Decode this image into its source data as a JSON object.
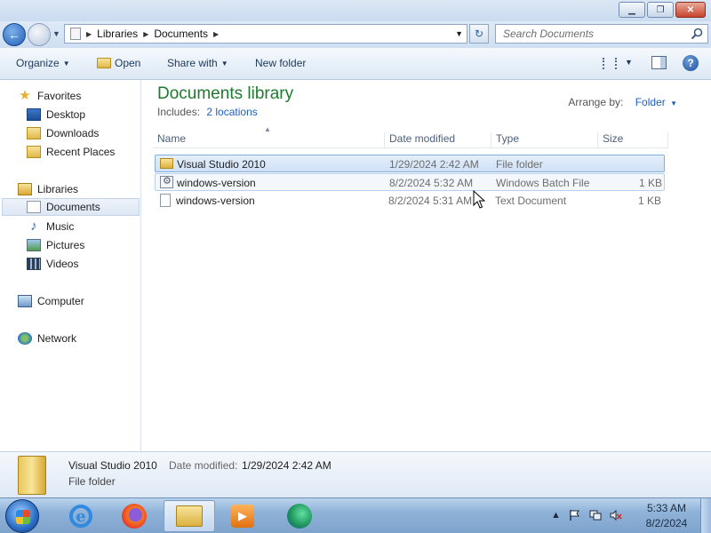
{
  "window": {
    "minimize_glyph": "▁",
    "maximize_glyph": "❐",
    "close_glyph": "✕"
  },
  "navbar": {
    "back_glyph": "←",
    "breadcrumbs": [
      "Libraries",
      "Documents"
    ],
    "search_placeholder": "Search Documents",
    "refresh_glyph": "↻"
  },
  "commands": {
    "organize": "Organize",
    "open": "Open",
    "share_with": "Share with",
    "new_folder": "New folder",
    "help_glyph": "?"
  },
  "sidebar": {
    "favorites": {
      "label": "Favorites",
      "items": [
        "Desktop",
        "Downloads",
        "Recent Places"
      ]
    },
    "libraries": {
      "label": "Libraries",
      "items": [
        "Documents",
        "Music",
        "Pictures",
        "Videos"
      ]
    },
    "computer": "Computer",
    "network": "Network"
  },
  "library": {
    "title": "Documents library",
    "includes_label": "Includes:",
    "locations_link": "2 locations",
    "arrange_label": "Arrange by:",
    "arrange_value": "Folder"
  },
  "columns": {
    "name": "Name",
    "date_modified": "Date modified",
    "type": "Type",
    "size": "Size"
  },
  "files": [
    {
      "name": "Visual Studio 2010",
      "date": "1/29/2024 2:42 AM",
      "type": "File folder",
      "size": ""
    },
    {
      "name": "windows-version",
      "date": "8/2/2024 5:32 AM",
      "type": "Windows Batch File",
      "size": "1 KB"
    },
    {
      "name": "windows-version",
      "date": "8/2/2024 5:31 AM",
      "type": "Text Document",
      "size": "1 KB"
    }
  ],
  "details": {
    "name": "Visual Studio 2010",
    "date_label": "Date modified:",
    "date_value": "1/29/2024 2:42 AM",
    "type": "File folder"
  },
  "taskbar": {
    "ie_glyph": "e",
    "wmp_glyph": "▶",
    "tray_arrow": "▲",
    "time": "5:33 AM",
    "date": "8/2/2024"
  }
}
